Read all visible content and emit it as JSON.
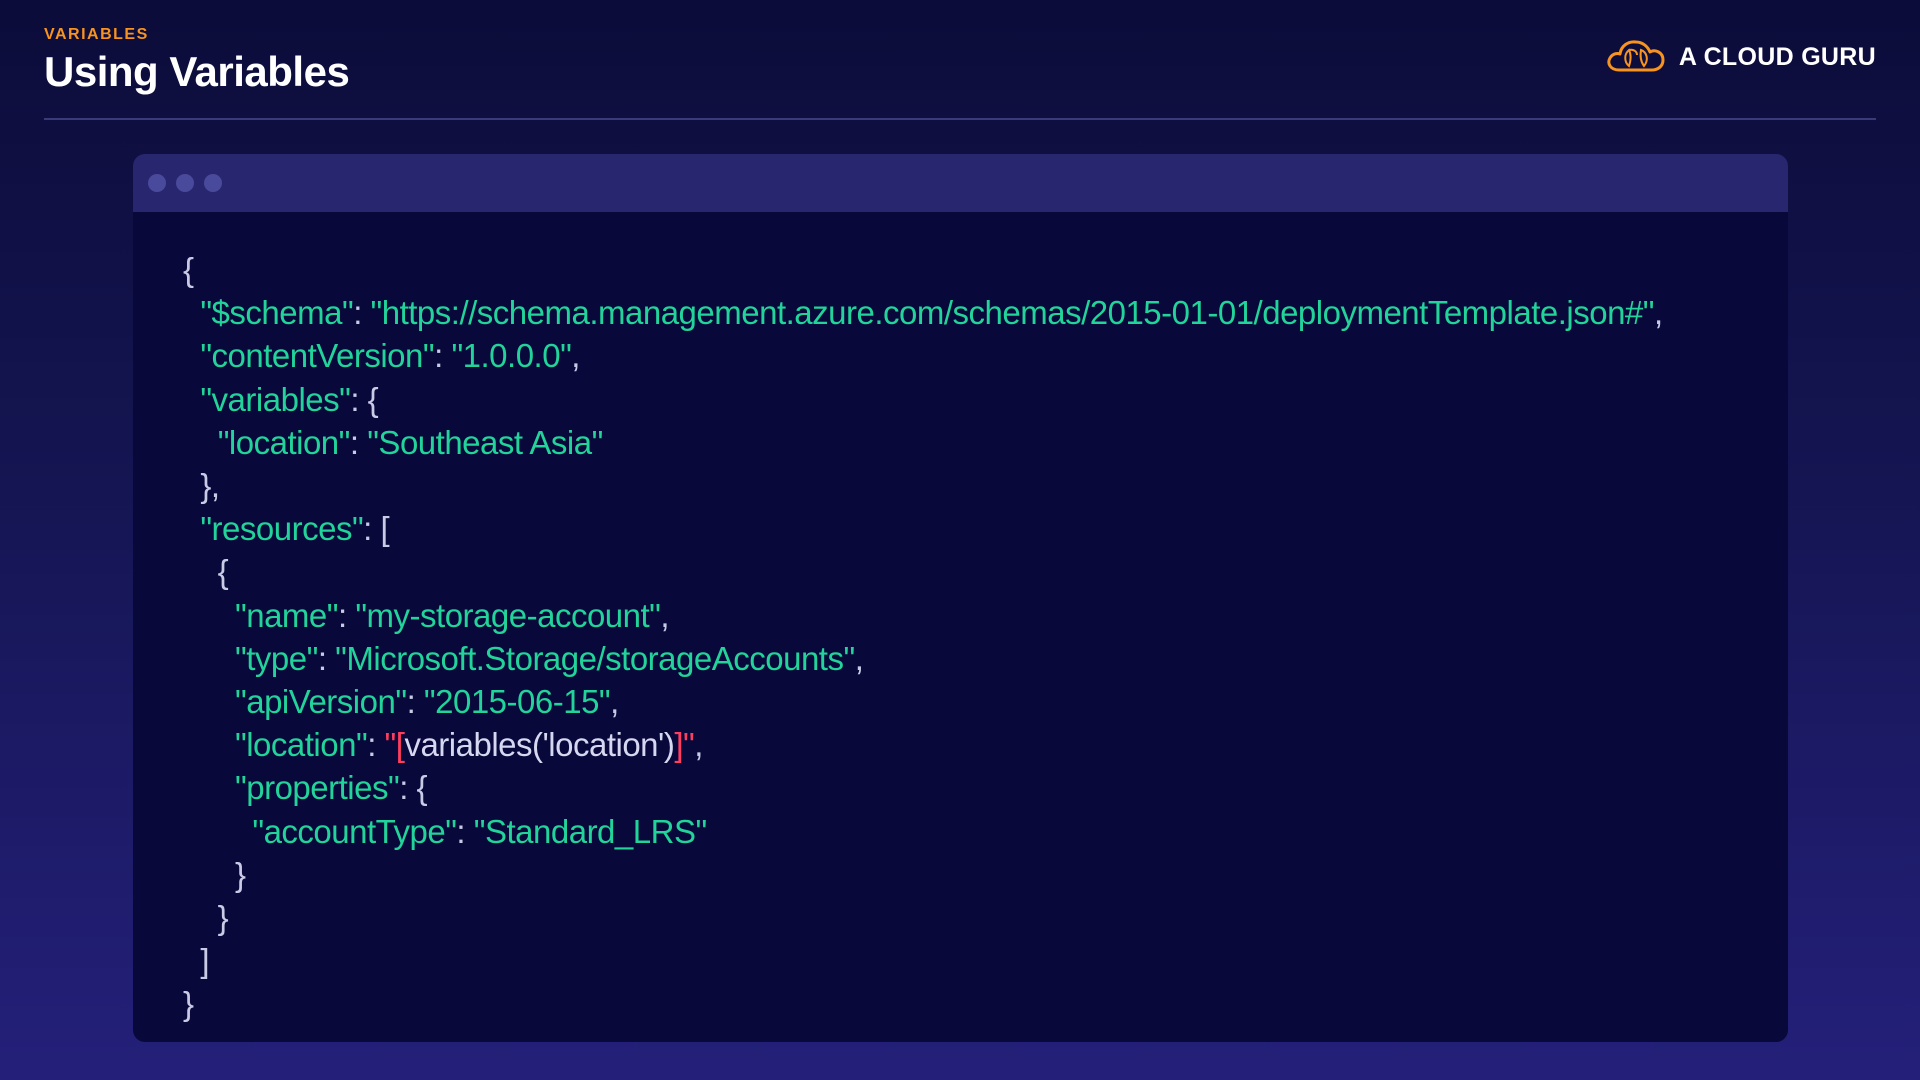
{
  "header": {
    "eyebrow": "VARIABLES",
    "title": "Using Variables",
    "brand": "A CLOUD GURU"
  },
  "code_lines": [
    "{",
    "  \"$schema\": \"https://schema.management.azure.com/schemas/2015-01-01/deploymentTemplate.json#\",",
    "  \"contentVersion\": \"1.0.0.0\",",
    "  \"variables\": {",
    "    \"location\": \"Southeast Asia\"",
    "  },",
    "  \"resources\": [",
    "    {",
    "      \"name\": \"my-storage-account\",",
    "      \"type\": \"Microsoft.Storage/storageAccounts\",",
    "      \"apiVersion\": \"2015-06-15\",",
    "      \"location\": \"[variables('location')]\",",
    "      \"properties\": {",
    "        \"accountType\": \"Standard_LRS\"",
    "      }",
    "    }",
    "  ]",
    "}"
  ],
  "colors": {
    "accent": "#f7931e",
    "string": "#22d39a",
    "punctuation": "#c9cbe6",
    "bracket_highlight": "#ff3d5f"
  },
  "icons": {
    "brand": "cloud-logo-icon",
    "window_dots": [
      "window-dot-icon",
      "window-dot-icon",
      "window-dot-icon"
    ]
  }
}
